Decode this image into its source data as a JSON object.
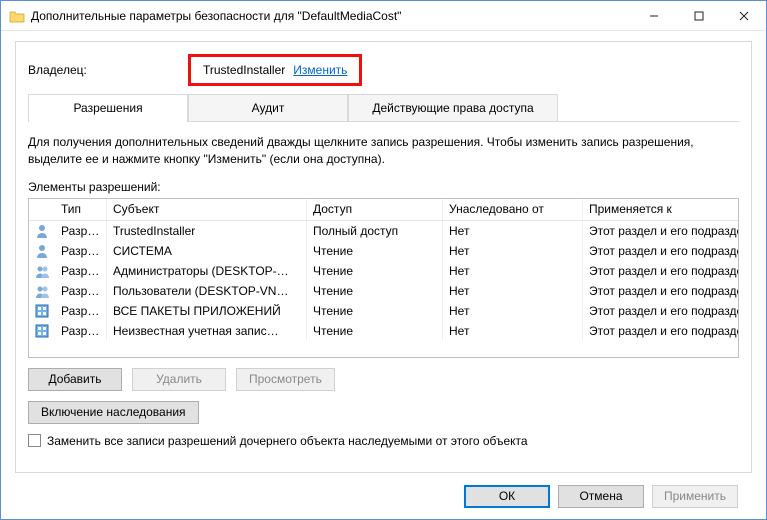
{
  "window": {
    "title": "Дополнительные параметры безопасности  для \"DefaultMediaCost\""
  },
  "owner": {
    "label": "Владелец:",
    "value": "TrustedInstaller",
    "change_link": "Изменить"
  },
  "tabs": {
    "permissions": "Разрешения",
    "audit": "Аудит",
    "effective": "Действующие права доступа"
  },
  "instructions": "Для получения дополнительных сведений дважды щелкните запись разрешения. Чтобы изменить запись разрешения, выделите ее и нажмите кнопку \"Изменить\" (если она доступна).",
  "elements_label": "Элементы разрешений:",
  "columns": {
    "type": "Тип",
    "subject": "Субъект",
    "access": "Доступ",
    "inherited": "Унаследовано от",
    "applies": "Применяется к"
  },
  "rows": [
    {
      "icon": "user",
      "type": "Разр…",
      "subject": "TrustedInstaller",
      "access": "Полный доступ",
      "inherited": "Нет",
      "applies": "Этот раздел и его подразделы"
    },
    {
      "icon": "user",
      "type": "Разр…",
      "subject": "СИСТЕМА",
      "access": "Чтение",
      "inherited": "Нет",
      "applies": "Этот раздел и его подразделы"
    },
    {
      "icon": "group",
      "type": "Разр…",
      "subject": "Администраторы (DESKTOP-…",
      "access": "Чтение",
      "inherited": "Нет",
      "applies": "Этот раздел и его подразделы"
    },
    {
      "icon": "group",
      "type": "Разр…",
      "subject": "Пользователи (DESKTOP-VN…",
      "access": "Чтение",
      "inherited": "Нет",
      "applies": "Этот раздел и его подразделы"
    },
    {
      "icon": "pkg",
      "type": "Разр…",
      "subject": "ВСЕ ПАКЕТЫ ПРИЛОЖЕНИЙ",
      "access": "Чтение",
      "inherited": "Нет",
      "applies": "Этот раздел и его подразделы"
    },
    {
      "icon": "pkg",
      "type": "Разр…",
      "subject": "Неизвестная учетная запис…",
      "access": "Чтение",
      "inherited": "Нет",
      "applies": "Этот раздел и его подразделы"
    }
  ],
  "buttons": {
    "add": "Добавить",
    "remove": "Удалить",
    "view": "Просмотреть",
    "enable_inherit": "Включение наследования",
    "replace_chk": "Заменить все записи разрешений дочернего объекта наследуемыми от этого объекта",
    "ok": "ОК",
    "cancel": "Отмена",
    "apply": "Применить"
  }
}
